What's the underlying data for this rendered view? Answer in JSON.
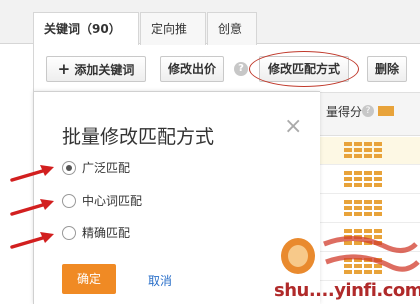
{
  "tabs": [
    {
      "label": "关键词（90）"
    },
    {
      "label": "定向推广"
    },
    {
      "label": "创意"
    }
  ],
  "toolbar": {
    "add_keyword": "添加关键词",
    "add_icon": "plus-icon",
    "edit_bid": "修改出价",
    "help_icon": "question-icon",
    "edit_match": "修改匹配方式",
    "delete": "删除"
  },
  "table": {
    "column_partial": "量得分",
    "row_count": 5
  },
  "dialog": {
    "title": "批量修改匹配方式",
    "close_icon": "close-icon",
    "options": [
      {
        "label": "广泛匹配",
        "checked": true
      },
      {
        "label": "中心词匹配",
        "checked": false
      },
      {
        "label": "精确匹配",
        "checked": false
      }
    ],
    "confirm": "确定",
    "cancel": "取消"
  },
  "watermark": {
    "text": "shu....yinfi.com"
  },
  "colors": {
    "accent_orange": "#f08a24",
    "annotation_red": "#d21f1f",
    "quality_bar": "#e8a33a",
    "link_blue": "#2a6fc9"
  }
}
